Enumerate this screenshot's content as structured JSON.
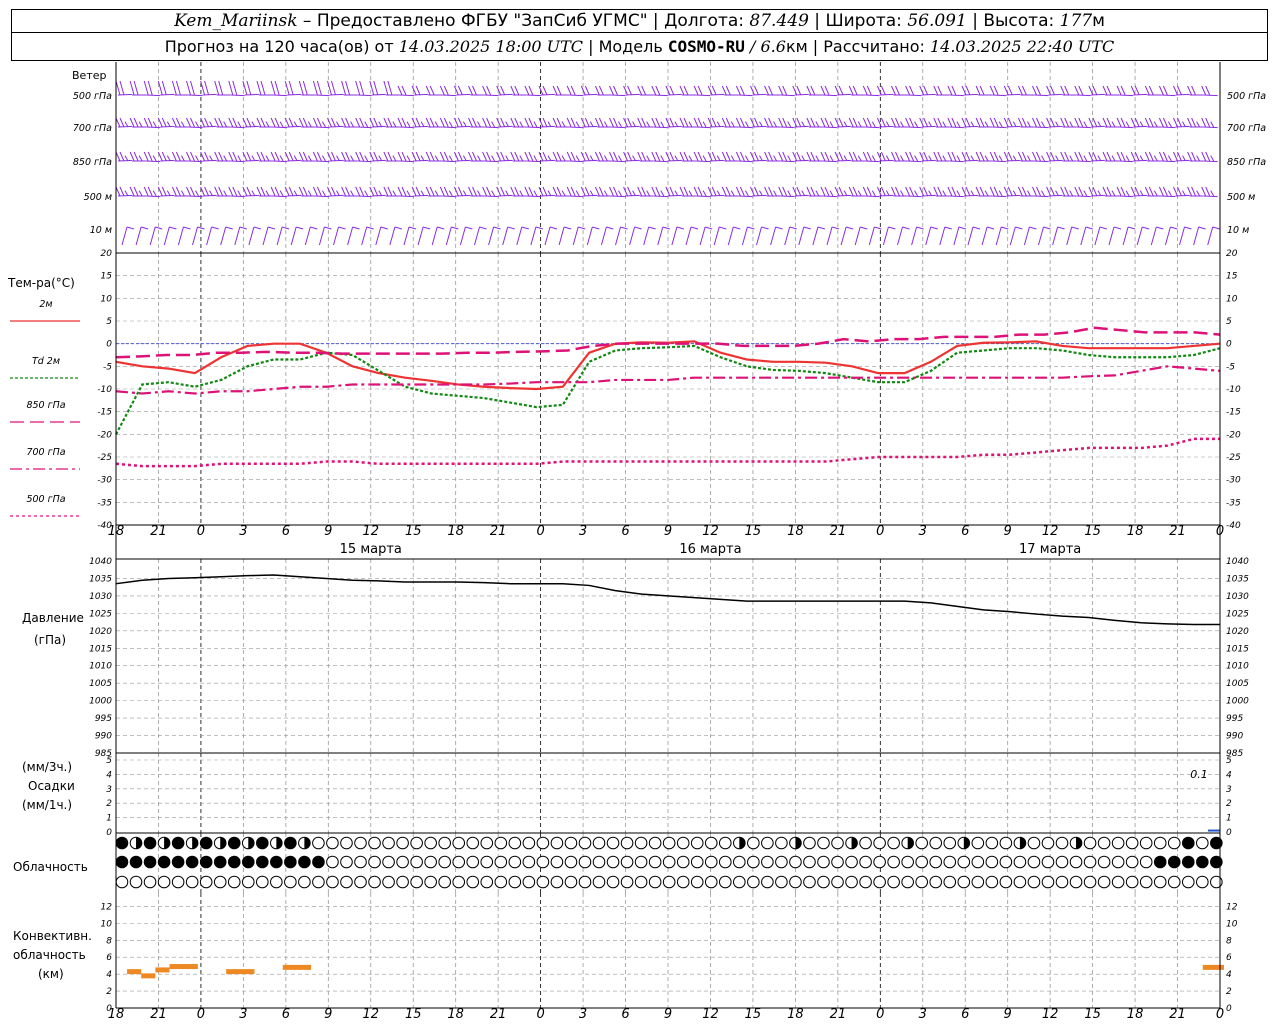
{
  "header": {
    "station": "Kem_Mariinsk",
    "dash": " – ",
    "provider": "Предоставлено ФГБУ \"ЗапСиб УГМС\"",
    "sep": " | ",
    "lon_label": "Долгота: ",
    "lon": "87.449",
    "lat_label": "Широта: ",
    "lat": "56.091",
    "alt_label": "Высота: ",
    "alt": "177",
    "alt_unit": "м",
    "fc_label": "Прогноз на 120 часа(ов) от ",
    "fc_date": "14.03.2025 18:00 UTC",
    "model_label": "  |  Модель ",
    "model": "COSMO-RU",
    "model_res": " / 6.6",
    "model_res_unit": "км",
    "calc_label": " | Рассчитано: ",
    "calc_date": "14.03.2025 22:40 UTC"
  },
  "time_axis": {
    "hour_labels": [
      "18",
      "21",
      "0",
      "3",
      "6",
      "9",
      "12",
      "15",
      "18",
      "21",
      "0",
      "3",
      "6",
      "9",
      "12",
      "15",
      "18",
      "21",
      "0",
      "3",
      "6",
      "9",
      "12",
      "15",
      "18",
      "21",
      "0"
    ],
    "day_labels": [
      "15 марта",
      "16 марта",
      "17 марта"
    ]
  },
  "wind": {
    "title": "Ветер",
    "levels": [
      "500 гПа",
      "700 гПа",
      "850 гПа",
      "500 м",
      "10  м"
    ],
    "color": "#8a2be2"
  },
  "temp": {
    "title": "Тем-ра(°C)",
    "legend": [
      {
        "label": "2м",
        "color": "#ee3333"
      },
      {
        "label": "Td  2м",
        "color": "#118811"
      },
      {
        "label": "850 гПа",
        "color": "#cc2288"
      },
      {
        "label": "700 гПа",
        "color": "#dd1177"
      },
      {
        "label": "500 гПа",
        "color": "#dd1177"
      }
    ],
    "ticks": [
      "20",
      "15",
      "10",
      "5",
      "0",
      "-5",
      "-10",
      "-15",
      "-20",
      "-25",
      "-30",
      "-35",
      "-40"
    ]
  },
  "pressure": {
    "label1": "Давление",
    "label2": "(гПа)",
    "ticks": [
      "1040",
      "1035",
      "1030",
      "1025",
      "1020",
      "1015",
      "1010",
      "1005",
      "1000",
      "995",
      "990",
      "985"
    ]
  },
  "precip": {
    "label1": "(мм/3ч.)",
    "label2": "Осадки",
    "label3": "(мм/1ч.)",
    "ticks": [
      "5",
      "4",
      "3",
      "2",
      "1",
      "0"
    ],
    "annotation": "0.1",
    "bar_color": "#2255cc"
  },
  "cloud": {
    "label": "Облачность"
  },
  "conv": {
    "label1": "Конвективн.",
    "label2": "облачность",
    "label3": "(км)",
    "ticks": [
      "12",
      "10",
      "8",
      "6",
      "4",
      "2",
      "0"
    ],
    "color": "#ee8822"
  },
  "chart_data": [
    {
      "type": "line",
      "title": "Тем-ра(°C)",
      "x": [
        0,
        3,
        6,
        9,
        12,
        15,
        18,
        21,
        24,
        27,
        30,
        33,
        36,
        39,
        42,
        45,
        48,
        51,
        54,
        57,
        60,
        63,
        66,
        69,
        72,
        75,
        78,
        81,
        84,
        87,
        90,
        93,
        96,
        99,
        102,
        105,
        108,
        111,
        114,
        117,
        120,
        123,
        126,
        129,
        132,
        135,
        138,
        141,
        144,
        147,
        150,
        153,
        156
      ],
      "ylim": [
        -40,
        20
      ],
      "series": [
        {
          "name": "2м",
          "values": [
            -4,
            -5,
            -5.5,
            -6.5,
            -3,
            -0.5,
            0,
            0,
            -2,
            -5,
            -6.5,
            -7.5,
            -8.2,
            -9,
            -9.5,
            -9.8,
            -10,
            -9.5,
            -2,
            0,
            0.3,
            0.2,
            0.5,
            -2,
            -3.5,
            -4,
            -4,
            -4.2,
            -5,
            -6.5,
            -6.5,
            -4,
            -0.5,
            0.2,
            0.3,
            0.5,
            -0.5,
            -1,
            -1,
            -1,
            -1,
            -0.5,
            0
          ]
        },
        {
          "name": "Td  2м",
          "values": [
            -20,
            -9,
            -8.5,
            -9.5,
            -8,
            -5,
            -3.5,
            -3.5,
            -2,
            -2.5,
            -6,
            -9.5,
            -11,
            -11.5,
            -12,
            -13,
            -14,
            -13.5,
            -4,
            -1.5,
            -1,
            -0.8,
            -0.5,
            -3,
            -5,
            -5.8,
            -6,
            -6.5,
            -7.5,
            -8.5,
            -8.5,
            -6,
            -2,
            -1.5,
            -1,
            -1,
            -1.5,
            -2.5,
            -3,
            -3,
            -3,
            -2.5,
            -1
          ]
        },
        {
          "name": "850 гПа",
          "values": [
            -3,
            -2.8,
            -2.5,
            -2.5,
            -2,
            -2,
            -1.8,
            -2,
            -2,
            -2.2,
            -2.2,
            -2.2,
            -2.2,
            -2.2,
            -2,
            -2,
            -1.8,
            -1.7,
            -1.5,
            -0.5,
            0,
            0,
            0,
            0,
            0,
            -0.5,
            -0.5,
            -0.5,
            0,
            1,
            0.5,
            1,
            1,
            1.5,
            1.5,
            1.5,
            2,
            2,
            2.5,
            3.5,
            3,
            2.5,
            2.5,
            2.5,
            2
          ]
        },
        {
          "name": "700 гПа",
          "values": [
            -10.5,
            -11,
            -10.5,
            -11,
            -10.5,
            -10.5,
            -10,
            -9.5,
            -9.5,
            -9,
            -9,
            -9,
            -9,
            -9,
            -9,
            -8.8,
            -8.5,
            -8.5,
            -8.5,
            -8,
            -8,
            -8,
            -7.5,
            -7.5,
            -7.5,
            -7.5,
            -7.5,
            -7.5,
            -7.5,
            -7.5,
            -7.5,
            -7.5,
            -7.5,
            -7.5,
            -7.5,
            -7.5,
            -7.5,
            -7.2,
            -7,
            -6,
            -5,
            -5.5,
            -6
          ]
        },
        {
          "name": "500 гПа",
          "values": [
            -26.5,
            -27,
            -27,
            -27,
            -26.5,
            -26.5,
            -26.5,
            -26.5,
            -26,
            -26,
            -26.5,
            -26.5,
            -26.5,
            -26.5,
            -26.5,
            -26.5,
            -26.5,
            -26,
            -26,
            -26,
            -26,
            -26,
            -26,
            -26,
            -26,
            -26,
            -26,
            -26,
            -25.5,
            -25,
            -25,
            -25,
            -25,
            -24.5,
            -24.5,
            -24,
            -23.5,
            -23,
            -23,
            -23,
            -22.5,
            -21,
            -21
          ]
        }
      ]
    },
    {
      "type": "line",
      "title": "Давление",
      "ylabel": "(гПа)",
      "ylim": [
        985,
        1040
      ],
      "series": [
        {
          "name": "Давление",
          "values": [
            1033.5,
            1034.5,
            1035,
            1035.2,
            1035.5,
            1035.8,
            1036,
            1035.5,
            1035,
            1034.5,
            1034.3,
            1034,
            1034,
            1034,
            1033.8,
            1033.5,
            1033.5,
            1033.5,
            1033,
            1031.5,
            1030.5,
            1030,
            1029.5,
            1029,
            1028.5,
            1028.5,
            1028.5,
            1028.5,
            1028.5,
            1028.5,
            1028.5,
            1028,
            1027,
            1026,
            1025.5,
            1024.8,
            1024.2,
            1023.8,
            1023,
            1022.3,
            1022,
            1021.8,
            1021.8
          ]
        }
      ]
    },
    {
      "type": "bar",
      "title": "Осадки",
      "ylim": [
        0,
        5
      ],
      "annotation": "0.1",
      "values": [
        0,
        0,
        0,
        0,
        0,
        0,
        0,
        0,
        0,
        0,
        0,
        0,
        0,
        0,
        0,
        0,
        0,
        0,
        0,
        0,
        0,
        0,
        0,
        0,
        0,
        0,
        0,
        0,
        0,
        0,
        0,
        0,
        0,
        0,
        0,
        0,
        0,
        0,
        0,
        0,
        0.1
      ]
    },
    {
      "type": "bar",
      "title": "Конвективн. облачность (км)",
      "ylim": [
        0,
        13
      ],
      "segments": [
        {
          "start": 1,
          "end": 3,
          "value": 4.3
        },
        {
          "start": 3,
          "end": 5,
          "value": 3.8
        },
        {
          "start": 5,
          "end": 7,
          "value": 4.5
        },
        {
          "start": 7,
          "end": 11,
          "value": 4.9
        },
        {
          "start": 15,
          "end": 19,
          "value": 4.3
        },
        {
          "start": 23,
          "end": 27,
          "value": 4.8
        },
        {
          "start": 153,
          "end": 156,
          "value": 4.8
        }
      ]
    }
  ]
}
